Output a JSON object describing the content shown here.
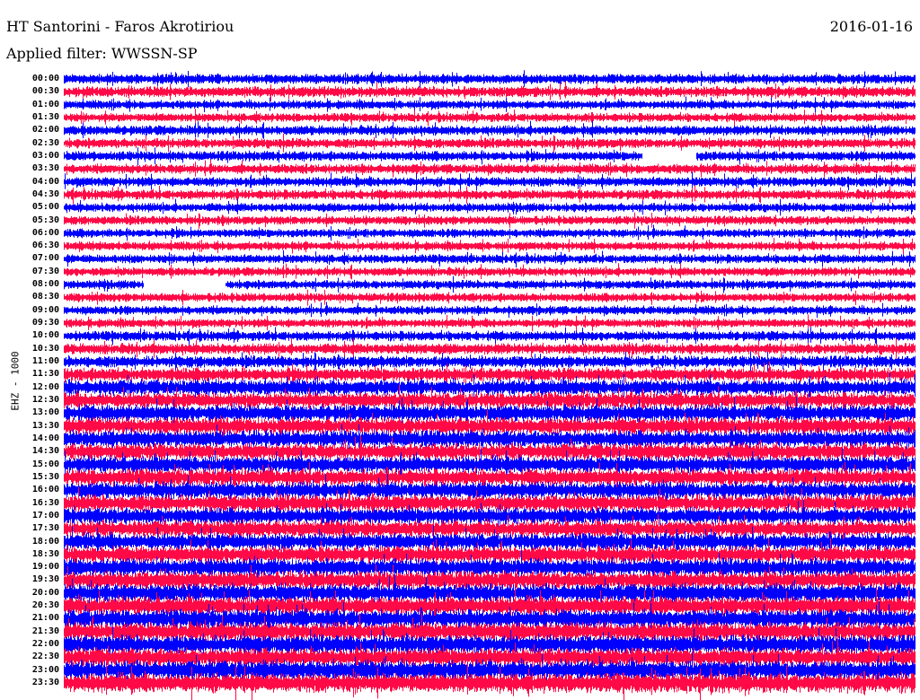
{
  "header": {
    "station": "HT Santorini - Faros Akrotiriou",
    "date": "2016-01-16",
    "filter": "Applied filter: WWSSN-SP"
  },
  "chart_data": {
    "type": "line",
    "subtype": "helicorder",
    "title": "HT Santorini - Faros Akrotiriou",
    "ylabel": "EHZ - 1000",
    "x_units": "minutes within trace",
    "xlim": [
      0,
      30
    ],
    "colors": [
      "#0000ff",
      "#ff0a46"
    ],
    "trace_labels": [
      "00:00",
      "00:30",
      "01:00",
      "01:30",
      "02:00",
      "02:30",
      "03:00",
      "03:30",
      "04:00",
      "04:30",
      "05:00",
      "05:30",
      "06:00",
      "06:30",
      "07:00",
      "07:30",
      "08:00",
      "08:30",
      "09:00",
      "09:30",
      "10:00",
      "10:30",
      "11:00",
      "11:30",
      "12:00",
      "12:30",
      "13:00",
      "13:30",
      "14:00",
      "14:30",
      "15:00",
      "15:30",
      "16:00",
      "16:30",
      "17:00",
      "17:30",
      "18:00",
      "18:30",
      "19:00",
      "19:30",
      "20:00",
      "20:30",
      "21:00",
      "21:30",
      "22:00",
      "22:30",
      "23:00",
      "23:30"
    ],
    "relative_amplitude": [
      0.5,
      0.55,
      0.45,
      0.45,
      0.5,
      0.5,
      0.5,
      0.5,
      0.5,
      0.5,
      0.45,
      0.45,
      0.45,
      0.45,
      0.45,
      0.45,
      0.45,
      0.45,
      0.45,
      0.45,
      0.5,
      0.55,
      0.6,
      0.7,
      0.8,
      0.8,
      0.85,
      0.85,
      0.85,
      0.85,
      0.85,
      0.85,
      0.85,
      0.85,
      0.85,
      0.85,
      0.85,
      0.85,
      0.9,
      0.9,
      0.95,
      0.95,
      0.95,
      0.95,
      0.95,
      0.95,
      1.0,
      1.0
    ],
    "gaps": [
      {
        "trace": "03:00",
        "from_min": 20.4,
        "to_min": 22.3
      },
      {
        "trace": "08:00",
        "from_min": 2.8,
        "to_min": 5.7
      }
    ]
  }
}
